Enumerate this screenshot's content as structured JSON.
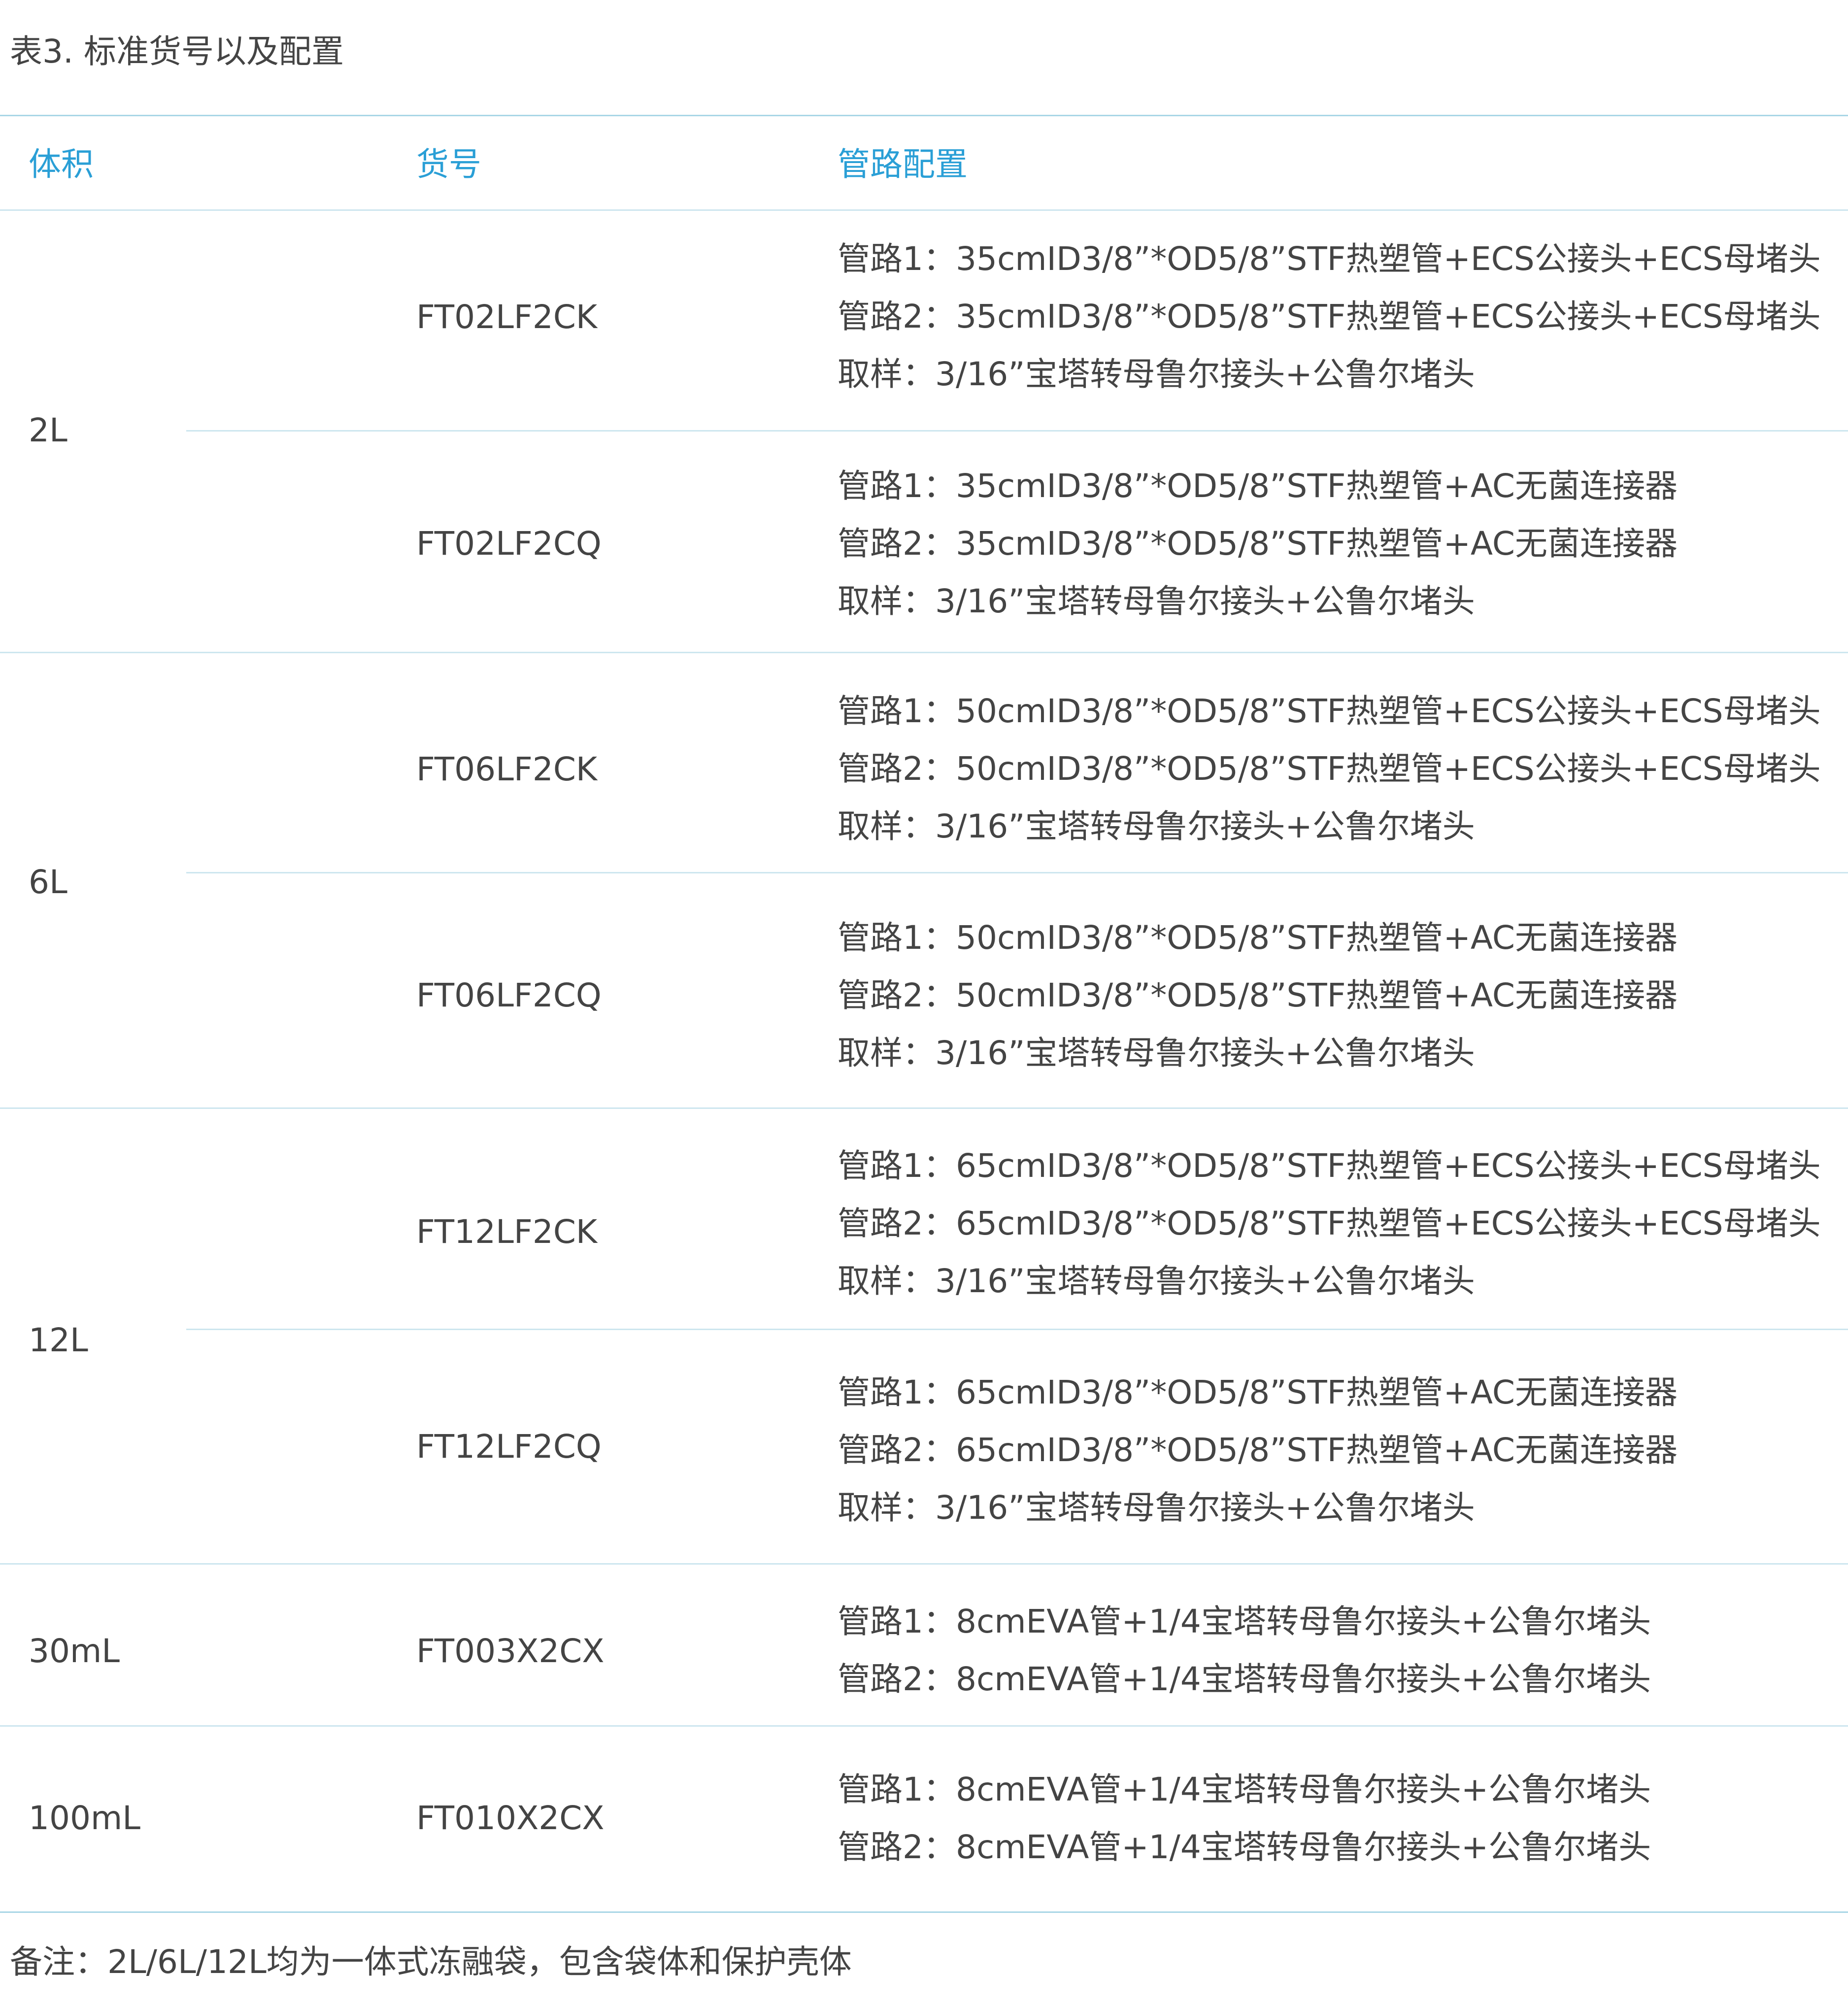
{
  "caption": "表3. 标准货号以及配置",
  "headers": {
    "volume": "体积",
    "sku": "货号",
    "config": "管路配置"
  },
  "rows": [
    {
      "volume": "2L",
      "items": [
        {
          "sku": "FT02LF2CK",
          "config": [
            "管路1：35cmID3/8”*OD5/8”STF热塑管+ECS公接头+ECS母堵头",
            "管路2：35cmID3/8”*OD5/8”STF热塑管+ECS公接头+ECS母堵头",
            "取样：3/16”宝塔转母鲁尔接头+公鲁尔堵头"
          ]
        },
        {
          "sku": "FT02LF2CQ",
          "config": [
            "管路1：35cmID3/8”*OD5/8”STF热塑管+AC无菌连接器",
            "管路2：35cmID3/8”*OD5/8”STF热塑管+AC无菌连接器",
            "取样：3/16”宝塔转母鲁尔接头+公鲁尔堵头"
          ]
        }
      ]
    },
    {
      "volume": "6L",
      "items": [
        {
          "sku": "FT06LF2CK",
          "config": [
            "管路1：50cmID3/8”*OD5/8”STF热塑管+ECS公接头+ECS母堵头",
            "管路2：50cmID3/8”*OD5/8”STF热塑管+ECS公接头+ECS母堵头",
            "取样：3/16”宝塔转母鲁尔接头+公鲁尔堵头"
          ]
        },
        {
          "sku": "FT06LF2CQ",
          "config": [
            "管路1：50cmID3/8”*OD5/8”STF热塑管+AC无菌连接器",
            "管路2：50cmID3/8”*OD5/8”STF热塑管+AC无菌连接器",
            "取样：3/16”宝塔转母鲁尔接头+公鲁尔堵头"
          ]
        }
      ]
    },
    {
      "volume": "12L",
      "items": [
        {
          "sku": "FT12LF2CK",
          "config": [
            "管路1：65cmID3/8”*OD5/8”STF热塑管+ECS公接头+ECS母堵头",
            "管路2：65cmID3/8”*OD5/8”STF热塑管+ECS公接头+ECS母堵头",
            "取样：3/16”宝塔转母鲁尔接头+公鲁尔堵头"
          ]
        },
        {
          "sku": "FT12LF2CQ",
          "config": [
            "管路1：65cmID3/8”*OD5/8”STF热塑管+AC无菌连接器",
            "管路2：65cmID3/8”*OD5/8”STF热塑管+AC无菌连接器",
            "取样：3/16”宝塔转母鲁尔接头+公鲁尔堵头"
          ]
        }
      ]
    },
    {
      "volume": "30mL",
      "items": [
        {
          "sku": "FT003X2CX",
          "config": [
            "管路1：8cmEVA管+1/4宝塔转母鲁尔接头+公鲁尔堵头",
            "管路2：8cmEVA管+1/4宝塔转母鲁尔接头+公鲁尔堵头"
          ]
        }
      ]
    },
    {
      "volume": "100mL",
      "items": [
        {
          "sku": "FT010X2CX",
          "config": [
            "管路1：8cmEVA管+1/4宝塔转母鲁尔接头+公鲁尔堵头",
            "管路2：8cmEVA管+1/4宝塔转母鲁尔接头+公鲁尔堵头"
          ]
        }
      ]
    }
  ],
  "note": "备注：2L/6L/12L均为一体式冻融袋，包含袋体和保护壳体"
}
